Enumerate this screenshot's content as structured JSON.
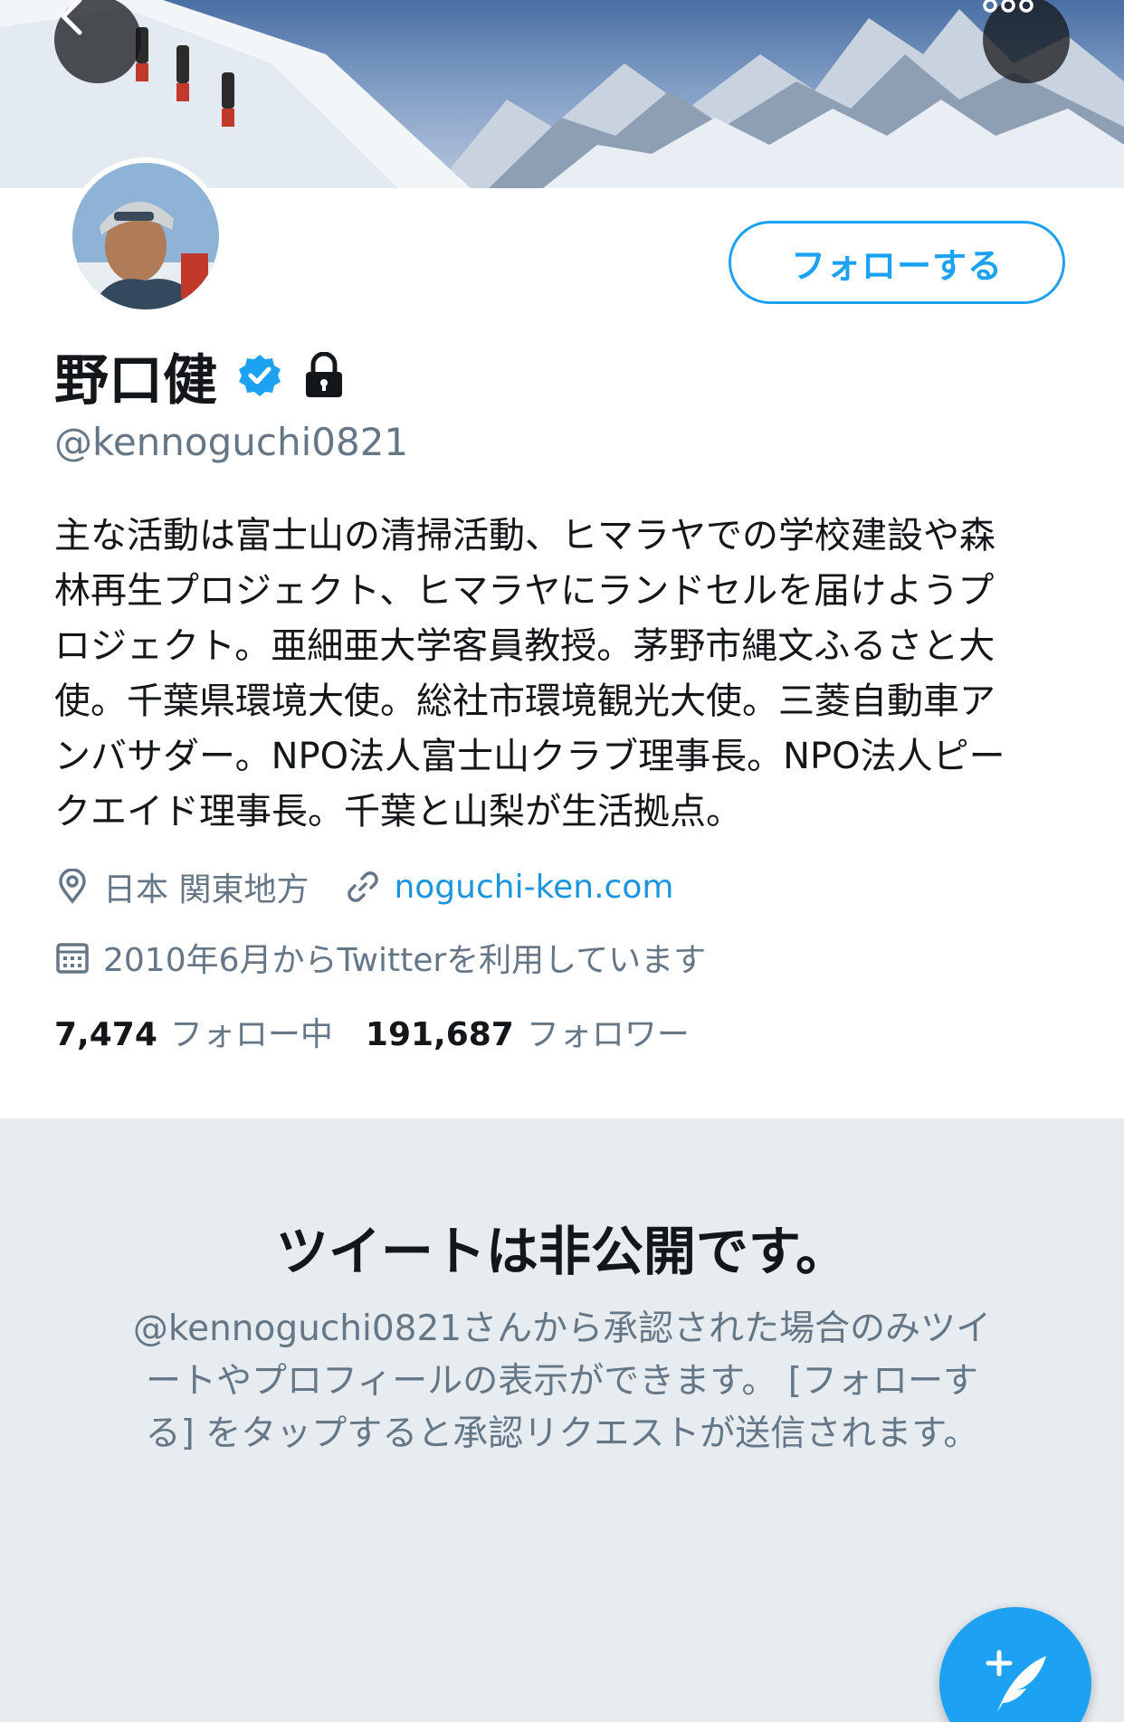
{
  "nav": {
    "back_icon": "chevron-left-icon",
    "more_icon": "more-dots-icon"
  },
  "profile": {
    "display_name": "野口健",
    "handle": "@kennoguchi0821",
    "follow_button": "フォローする",
    "bio_lines": [
      "主な活動は富士山の清掃活動、ヒマラヤでの学校建設や森",
      "林再生プロジェクト、ヒマラヤにランドセルを届けようプ",
      "ロジェクト。亜細亜大学客員教授。茅野市縄文ふるさと大",
      "使。千葉県環境大使。総社市環境観光大使。三菱自動車ア",
      "ンバサダー。NPO法人富士山クラブ理事長。NPO法人ピー",
      "クエイド理事長。千葉と山梨が生活拠点。"
    ],
    "location": "日本 関東地方",
    "website": "noguchi-ken.com",
    "joined": "2010年6月からTwitterを利用しています",
    "following_count": "7,474",
    "following_label": "フォロー中",
    "followers_count": "191,687",
    "followers_label": "フォロワー"
  },
  "private_notice": {
    "title": "ツイートは非公開です。",
    "desc_lines": [
      "@kennoguchi0821さんから承認された場合のみツイ",
      "ートやプロフィールの表示ができます。 [フォローす",
      "る] をタップすると承認リクエストが送信されます。"
    ]
  },
  "colors": {
    "accent": "#1da1f2",
    "link": "#1b95e0",
    "secondary_text": "#657786",
    "private_bg": "#e6ecf0"
  },
  "icons": {
    "verified": "verified-badge-icon",
    "lock": "lock-icon",
    "location": "location-pin-icon",
    "link": "link-icon",
    "calendar": "calendar-icon",
    "compose": "compose-tweet-icon"
  }
}
